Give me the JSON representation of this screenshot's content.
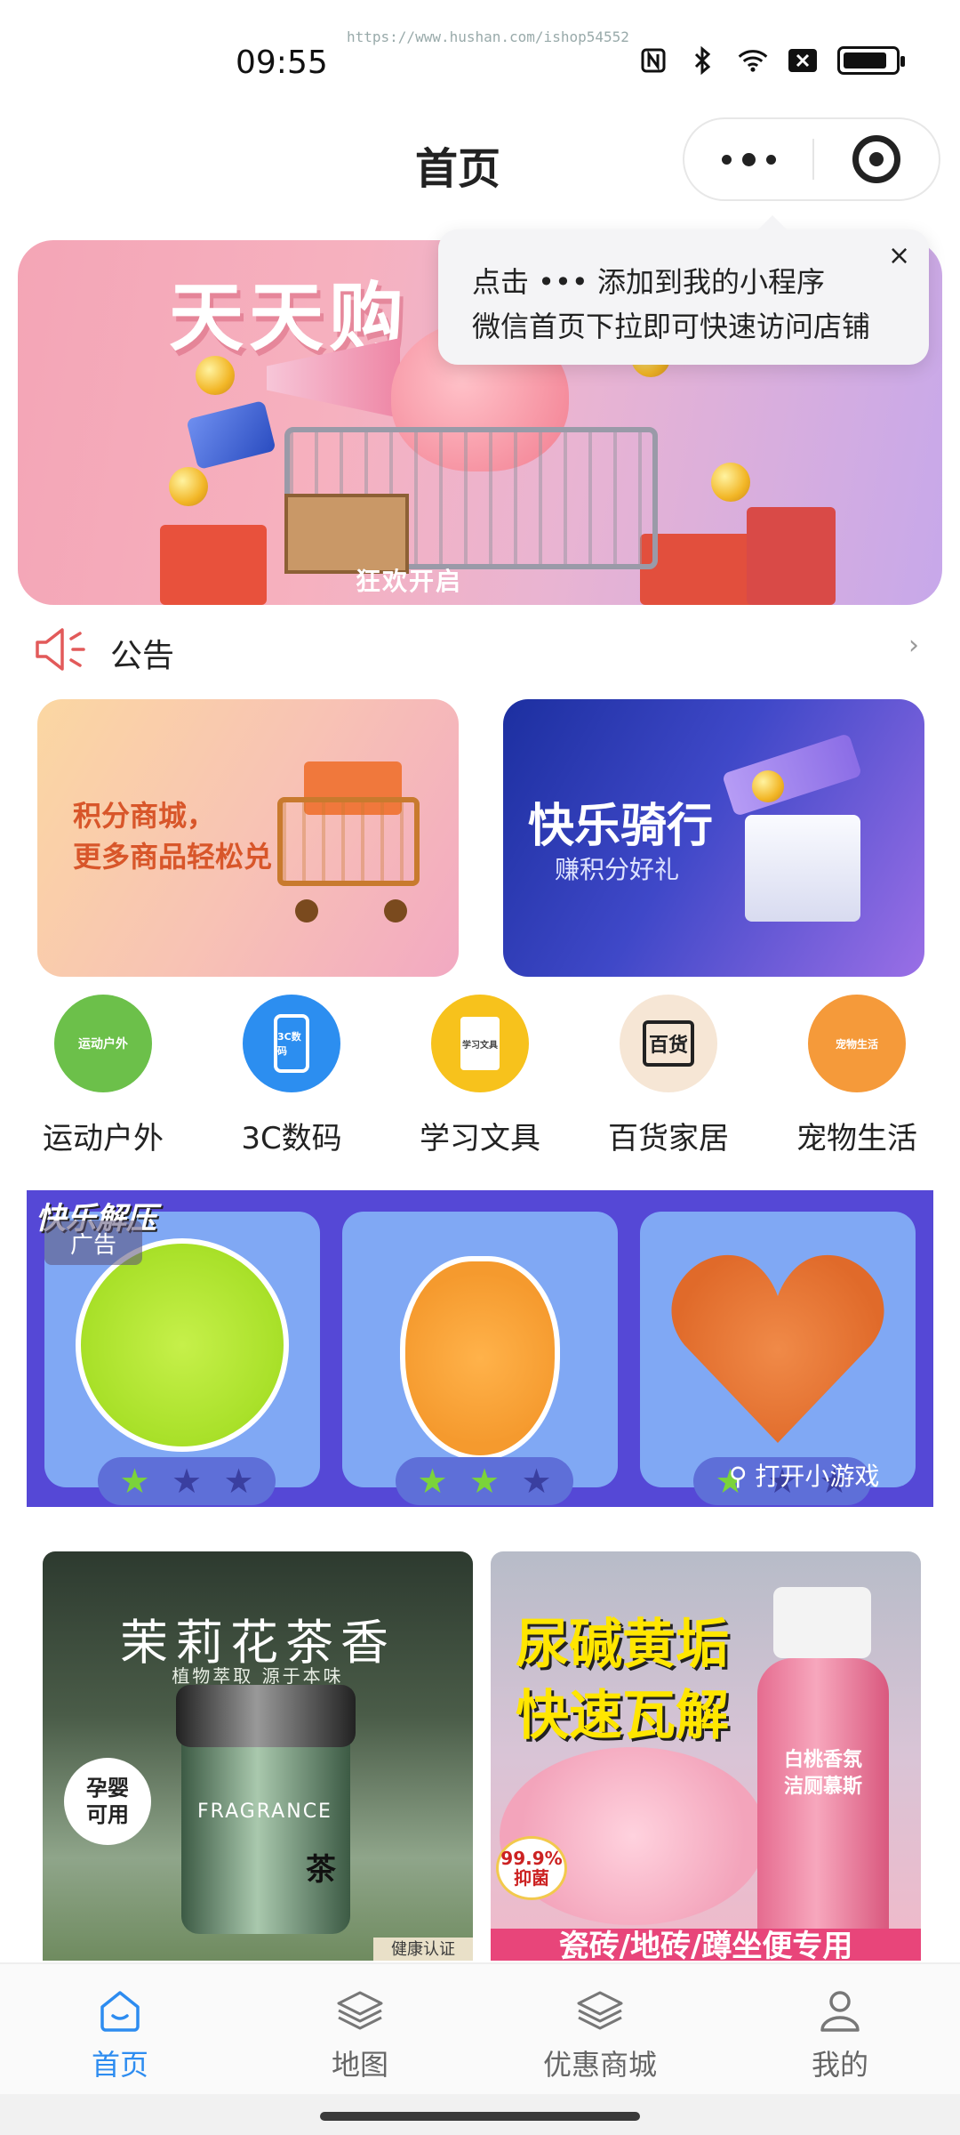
{
  "status_bar": {
    "time": "09:55",
    "watermark": "https://www.hushan.com/ishop54552",
    "icons": [
      "nfc-icon",
      "bluetooth-icon",
      "wifi-icon",
      "sim-off-icon",
      "battery-icon"
    ]
  },
  "header": {
    "title": "首页",
    "capsule": {
      "more_icon": "more-dots-icon",
      "close_icon": "target-close-icon"
    }
  },
  "banner": {
    "title": "天天购",
    "subtitle": "狂欢开启"
  },
  "tooltip": {
    "line1": "点击 ••• 添加到我的小程序",
    "line2": "微信首页下拉即可快速访问店铺",
    "close": "×"
  },
  "notice": {
    "icon": "speaker-icon",
    "label": "公告",
    "arrow": "›"
  },
  "promos": [
    {
      "text_line1": "积分商城，",
      "text_line2": "更多商品轻松兑"
    },
    {
      "title": "快乐骑行",
      "subtitle": "赚积分好礼"
    }
  ],
  "categories": [
    {
      "label": "运动户外",
      "icon_text": "运动户外",
      "color": "#6cc04a"
    },
    {
      "label": "3C数码",
      "icon_text": "3C数码",
      "color": "#2c8ef0"
    },
    {
      "label": "学习文具",
      "icon_text": "学习文具",
      "color": "#f7c21c"
    },
    {
      "label": "百货家居",
      "icon_text": "百货",
      "color": "#f6e6d5"
    },
    {
      "label": "宠物生活",
      "icon_text": "宠物生活",
      "color": "#f59a3a"
    }
  ],
  "ad": {
    "game_title": "快乐解压",
    "tag": "广告",
    "cta": "打开小游戏"
  },
  "products": [
    {
      "title": "茉莉花茶香",
      "subtitle": "植物萃取 源于本味",
      "badge_line1": "孕婴",
      "badge_line2": "可用",
      "jar_label": "FRAGRANCE",
      "tea_char": "茶",
      "cert": "健康认证"
    },
    {
      "title_line1": "尿碱黄垢",
      "title_line2": "快速瓦解",
      "brand_line1": "白桃香氛",
      "brand_line2": "洁厕慕斯",
      "badge": "99.9%抑菌",
      "bottom_line": "瓷砖/地砖/蹲坐便专用"
    }
  ],
  "tabbar": {
    "tabs": [
      {
        "label": "首页",
        "icon": "home-icon",
        "active": true
      },
      {
        "label": "地图",
        "icon": "layers-icon",
        "active": false
      },
      {
        "label": "优惠商城",
        "icon": "layers-icon",
        "active": false
      },
      {
        "label": "我的",
        "icon": "user-icon",
        "active": false
      }
    ],
    "active_color": "#2d8cf0"
  }
}
